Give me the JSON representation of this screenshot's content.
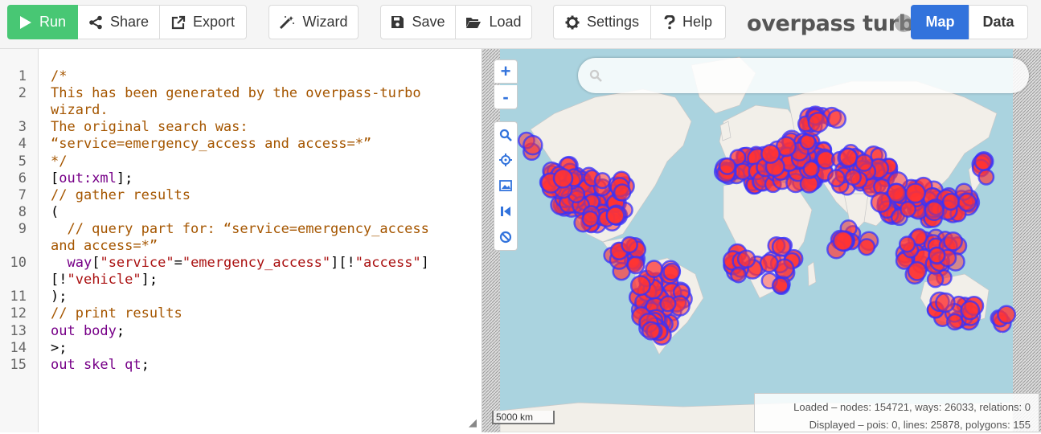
{
  "toolbar": {
    "run": "Run",
    "share": "Share",
    "export": "Export",
    "wizard": "Wizard",
    "save": "Save",
    "load": "Load",
    "settings": "Settings",
    "help": "Help",
    "app_title": "overpass turbo",
    "tab_map": "Map",
    "tab_data": "Data"
  },
  "editor": {
    "line_numbers": [
      "1",
      "2",
      "3",
      "4",
      "5",
      "6",
      "7",
      "8",
      "9",
      "10",
      "11",
      "12",
      "13",
      "14",
      "15"
    ],
    "lines": [
      {
        "parts": [
          {
            "t": "/*",
            "c": "cm"
          }
        ]
      },
      {
        "parts": [
          {
            "t": "This has been generated by the overpass-turbo",
            "c": "cm"
          }
        ]
      },
      {
        "parts": [
          {
            "t": "wizard.",
            "c": "cm"
          }
        ]
      },
      {
        "parts": [
          {
            "t": "The original search was:",
            "c": "cm"
          }
        ]
      },
      {
        "parts": [
          {
            "t": "“service=emergency_access and access=*”",
            "c": "cm"
          }
        ]
      },
      {
        "parts": [
          {
            "t": "*/",
            "c": "cm"
          }
        ]
      },
      {
        "parts": [
          {
            "t": "[",
            "c": ""
          },
          {
            "t": "out:xml",
            "c": "kw"
          },
          {
            "t": "];",
            "c": ""
          }
        ]
      },
      {
        "parts": [
          {
            "t": "// gather results",
            "c": "cm"
          }
        ]
      },
      {
        "parts": [
          {
            "t": "(",
            "c": ""
          }
        ]
      },
      {
        "parts": [
          {
            "t": "  // query part for: “service=emergency_access",
            "c": "cm"
          }
        ]
      },
      {
        "parts": [
          {
            "t": "and access=*”",
            "c": "cm"
          }
        ]
      },
      {
        "parts": [
          {
            "t": "  ",
            "c": ""
          },
          {
            "t": "way",
            "c": "kw"
          },
          {
            "t": "[",
            "c": ""
          },
          {
            "t": "\"service\"",
            "c": "st"
          },
          {
            "t": "=",
            "c": ""
          },
          {
            "t": "\"emergency_access\"",
            "c": "st"
          },
          {
            "t": "][!",
            "c": ""
          },
          {
            "t": "\"access\"",
            "c": "st"
          },
          {
            "t": "]",
            "c": ""
          }
        ]
      },
      {
        "parts": [
          {
            "t": "[!",
            "c": ""
          },
          {
            "t": "\"vehicle\"",
            "c": "st"
          },
          {
            "t": "];",
            "c": ""
          }
        ]
      },
      {
        "parts": [
          {
            "t": ");",
            "c": ""
          }
        ]
      },
      {
        "parts": [
          {
            "t": "// print results",
            "c": "cm"
          }
        ]
      },
      {
        "parts": [
          {
            "t": "out body",
            "c": "kw"
          },
          {
            "t": ";",
            "c": ""
          }
        ]
      },
      {
        "parts": [
          {
            "t": ">;",
            "c": ""
          }
        ]
      },
      {
        "parts": [
          {
            "t": "out skel qt",
            "c": "kw"
          },
          {
            "t": ";",
            "c": ""
          }
        ]
      }
    ]
  },
  "map": {
    "zoom_in": "+",
    "zoom_out": "-",
    "scale_label": "5000 km",
    "search_placeholder": "",
    "colors": {
      "water": "#aad3df",
      "land": "#f2efe9",
      "marker_fill": "#ff3333",
      "marker_stroke": "#3333ff",
      "accent": "#3273dc",
      "run": "#48c774"
    }
  },
  "status": {
    "loaded": "Loaded – nodes: 154721, ways: 26033, relations: 0",
    "displayed": "Displayed – pois: 0, lines: 25878, polygons: 155"
  }
}
